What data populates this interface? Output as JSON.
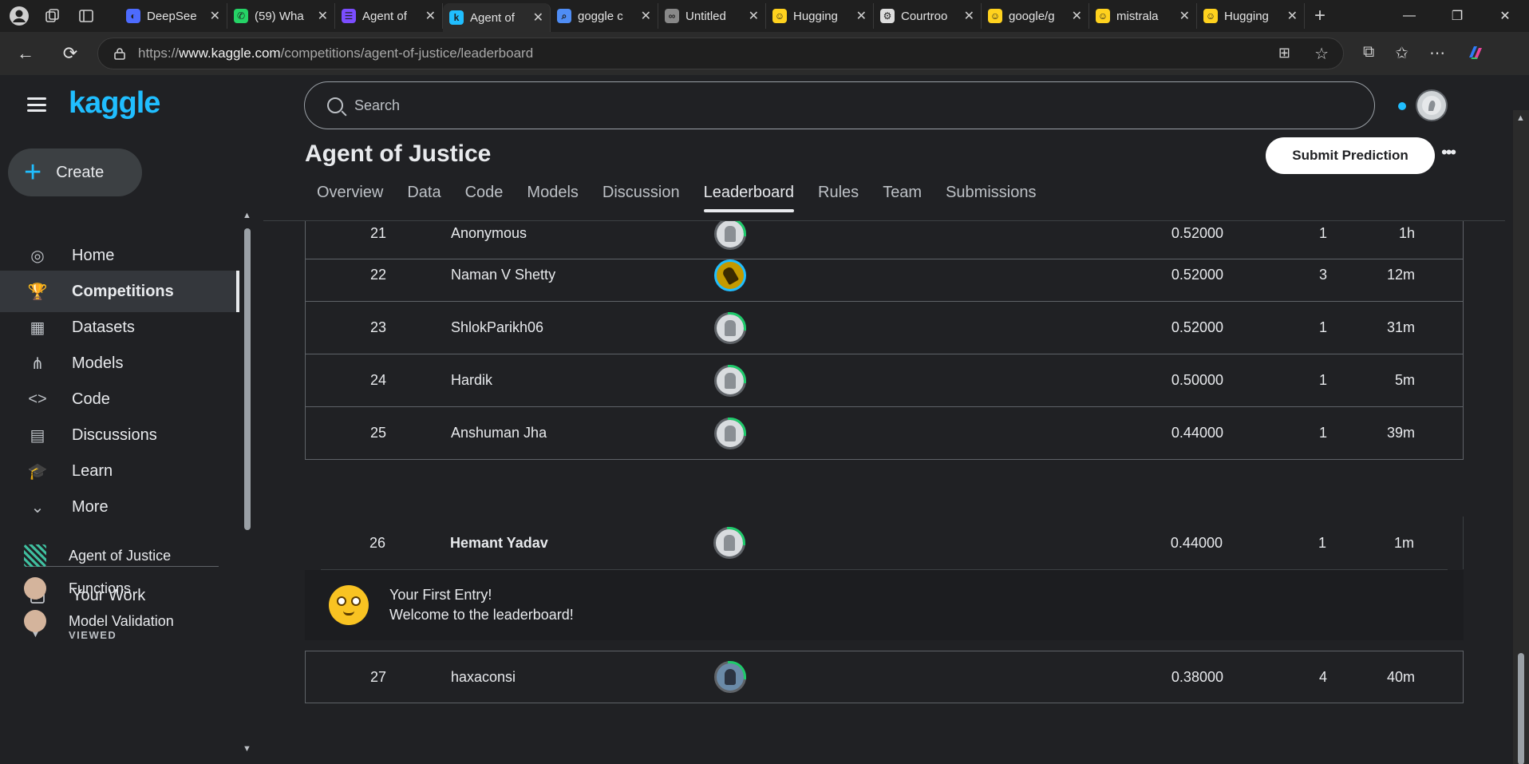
{
  "browser": {
    "tabs": [
      {
        "title": "DeepSee",
        "fav_color": "#4d6bfe",
        "fav_glyph": "◐"
      },
      {
        "title": "(59) Wha",
        "fav_color": "#25d366",
        "fav_glyph": "✆"
      },
      {
        "title": "Agent of",
        "fav_color": "#7b4dff",
        "fav_glyph": "☰"
      },
      {
        "title": "Agent of",
        "fav_color": "#20beff",
        "fav_glyph": "k",
        "active": true
      },
      {
        "title": "goggle c",
        "fav_color": "#4f8df5",
        "fav_glyph": "⌕"
      },
      {
        "title": "Untitled",
        "fav_color": "#888888",
        "fav_glyph": "∞"
      },
      {
        "title": "Hugging",
        "fav_color": "#ffd21e",
        "fav_glyph": "☺"
      },
      {
        "title": "Courtroo",
        "fav_color": "#dddddd",
        "fav_glyph": "⚙"
      },
      {
        "title": "google/g",
        "fav_color": "#ffd21e",
        "fav_glyph": "☺"
      },
      {
        "title": "mistrala",
        "fav_color": "#ffd21e",
        "fav_glyph": "☺"
      },
      {
        "title": "Hugging",
        "fav_color": "#ffd21e",
        "fav_glyph": "☺"
      }
    ],
    "url_prefix": "https://",
    "url_host": "www.kaggle.com",
    "url_path": "/competitions/agent-of-justice/leaderboard"
  },
  "sidebar": {
    "logo": "kaggle",
    "create_label": "Create",
    "items": [
      {
        "label": "Home",
        "icon": "compass-icon",
        "glyph": "◎"
      },
      {
        "label": "Competitions",
        "icon": "trophy-icon",
        "glyph": "🏆",
        "active": true
      },
      {
        "label": "Datasets",
        "icon": "table-icon",
        "glyph": "▦"
      },
      {
        "label": "Models",
        "icon": "models-icon",
        "glyph": "⋔"
      },
      {
        "label": "Code",
        "icon": "code-icon",
        "glyph": "<>"
      },
      {
        "label": "Discussions",
        "icon": "comment-icon",
        "glyph": "▤"
      },
      {
        "label": "Learn",
        "icon": "school-icon",
        "glyph": "🎓"
      },
      {
        "label": "More",
        "icon": "chevron-down-icon",
        "glyph": "⌄"
      }
    ],
    "your_work": "Your Work",
    "viewed_label": "VIEWED",
    "recent": [
      {
        "label": "Agent of Justice",
        "icon": "competition-thumb-icon"
      },
      {
        "label": "Functions",
        "icon": "avatar-icon"
      },
      {
        "label": "Model Validation",
        "icon": "avatar-icon"
      }
    ]
  },
  "header": {
    "search_placeholder": "Search",
    "title": "Agent of Justice",
    "submit_label": "Submit Prediction",
    "more_label": "•••"
  },
  "tabs": [
    "Overview",
    "Data",
    "Code",
    "Models",
    "Discussion",
    "Leaderboard",
    "Rules",
    "Team",
    "Submissions"
  ],
  "active_tab": "Leaderboard",
  "leaderboard": {
    "rows": [
      {
        "rank": "21",
        "team": "Anonymous",
        "avatar": "default",
        "score": "0.52000",
        "entries": "1",
        "last": "1h"
      },
      {
        "rank": "22",
        "team": "Naman V Shetty",
        "avatar": "gold",
        "score": "0.52000",
        "entries": "3",
        "last": "12m"
      },
      {
        "rank": "23",
        "team": "ShlokParikh06",
        "avatar": "default",
        "score": "0.52000",
        "entries": "1",
        "last": "31m"
      },
      {
        "rank": "24",
        "team": "Hardik",
        "avatar": "default",
        "score": "0.50000",
        "entries": "1",
        "last": "5m"
      },
      {
        "rank": "25",
        "team": "Anshuman Jha",
        "avatar": "default",
        "score": "0.44000",
        "entries": "1",
        "last": "39m"
      }
    ],
    "mine": {
      "rank": "26",
      "team": "Hemant Yadav",
      "avatar": "default",
      "score": "0.44000",
      "entries": "1",
      "last": "1m"
    },
    "first_entry_line1": "Your First Entry!",
    "first_entry_line2": "Welcome to the leaderboard!",
    "after": [
      {
        "rank": "27",
        "team": "haxaconsi",
        "avatar": "cat",
        "score": "0.38000",
        "entries": "4",
        "last": "40m"
      }
    ]
  }
}
